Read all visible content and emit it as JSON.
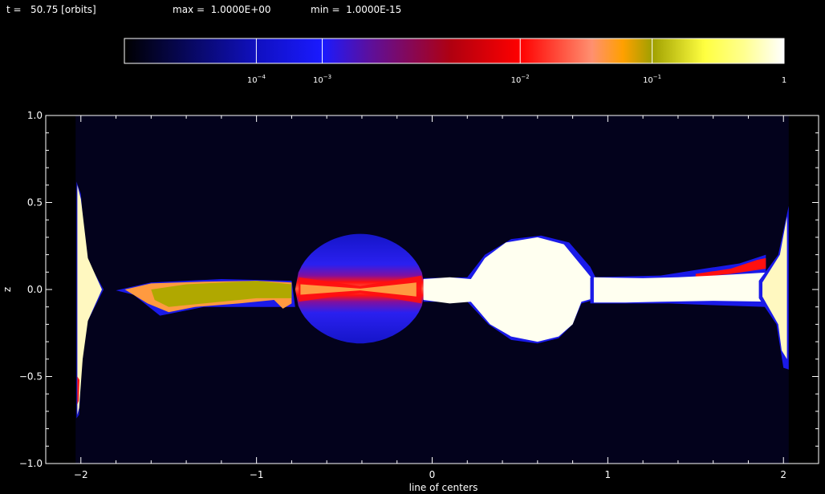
{
  "header": {
    "time_label": "t =   50.75 [orbits]",
    "max_label": "max =  1.0000E+00",
    "min_label": "min =  1.0000E-15"
  },
  "colorbar": {
    "ticks": [
      {
        "value": 0.0001,
        "base": "10",
        "exp": "-4"
      },
      {
        "value": 0.000316,
        "base": "10",
        "exp": "-3"
      },
      {
        "value": 0.01,
        "base": "10",
        "exp": "-2"
      },
      {
        "value": 0.1,
        "base": "10",
        "exp": "-1"
      },
      {
        "value": 1,
        "base": "1",
        "exp": ""
      }
    ],
    "stops": [
      {
        "value": 1e-05,
        "color": "#000000"
      },
      {
        "value": 0.0001,
        "color": "#1010c0"
      },
      {
        "value": 0.000316,
        "color": "#1a1aff"
      },
      {
        "value": 0.0007,
        "color": "#5a10a0"
      },
      {
        "value": 0.003,
        "color": "#b00010"
      },
      {
        "value": 0.01,
        "color": "#ff0000"
      },
      {
        "value": 0.035,
        "color": "#ff9070"
      },
      {
        "value": 0.06,
        "color": "#ffa000"
      },
      {
        "value": 0.1,
        "color": "#a0a000"
      },
      {
        "value": 0.25,
        "color": "#ffff40"
      },
      {
        "value": 0.5,
        "color": "#ffff90"
      },
      {
        "value": 1,
        "color": "#ffffff"
      }
    ]
  },
  "chart_data": {
    "type": "heatmap",
    "title": "",
    "xlabel": "line of centers",
    "ylabel": "z",
    "xlim": [
      -2.2,
      2.2
    ],
    "ylim": [
      -1.0,
      1.0
    ],
    "x_ticks": [
      -2,
      -1,
      0,
      1,
      2
    ],
    "x_tick_labels": [
      "−2",
      "−1",
      "0",
      "1",
      "2"
    ],
    "y_ticks": [
      -1.0,
      -0.5,
      0.0,
      0.5,
      1.0
    ],
    "y_tick_labels": [
      "−1.0",
      "−0.5",
      "0.0",
      "0.5",
      "1.0"
    ],
    "background_color": "#03021c",
    "colors": {
      "white": "#fffff0",
      "blue": "#1a1ae8",
      "red": "#ff1010",
      "orange": "#ff9a40",
      "olive": "#b0a800",
      "yellow_white": "#fff8c0"
    },
    "features": [
      {
        "name": "left-edge-disk",
        "x_range": [
          -2.02,
          -1.88
        ],
        "z_range": [
          -0.72,
          0.6
        ],
        "color": "yellow_white"
      },
      {
        "name": "left-stream",
        "x_range": [
          -1.8,
          -0.78
        ],
        "z_range": [
          -0.13,
          0.05
        ],
        "color": "olive"
      },
      {
        "name": "secondary-envelope",
        "center_x": -0.42,
        "center_z": 0.0,
        "x_range": [
          -0.78,
          -0.04
        ],
        "z_range": [
          -0.31,
          0.32
        ],
        "color": "blue"
      },
      {
        "name": "primary-disk",
        "center_x": 0.6,
        "center_z": 0.0,
        "x_range": [
          -0.05,
          0.95
        ],
        "z_range": [
          -0.3,
          0.3
        ],
        "color": "white"
      },
      {
        "name": "right-stream",
        "x_range": [
          0.92,
          1.95
        ],
        "z_range": [
          -0.07,
          0.1
        ],
        "color": "white"
      },
      {
        "name": "right-edge-disk",
        "x_range": [
          1.88,
          2.02
        ],
        "z_range": [
          -0.4,
          0.42
        ],
        "color": "yellow_white"
      }
    ]
  }
}
